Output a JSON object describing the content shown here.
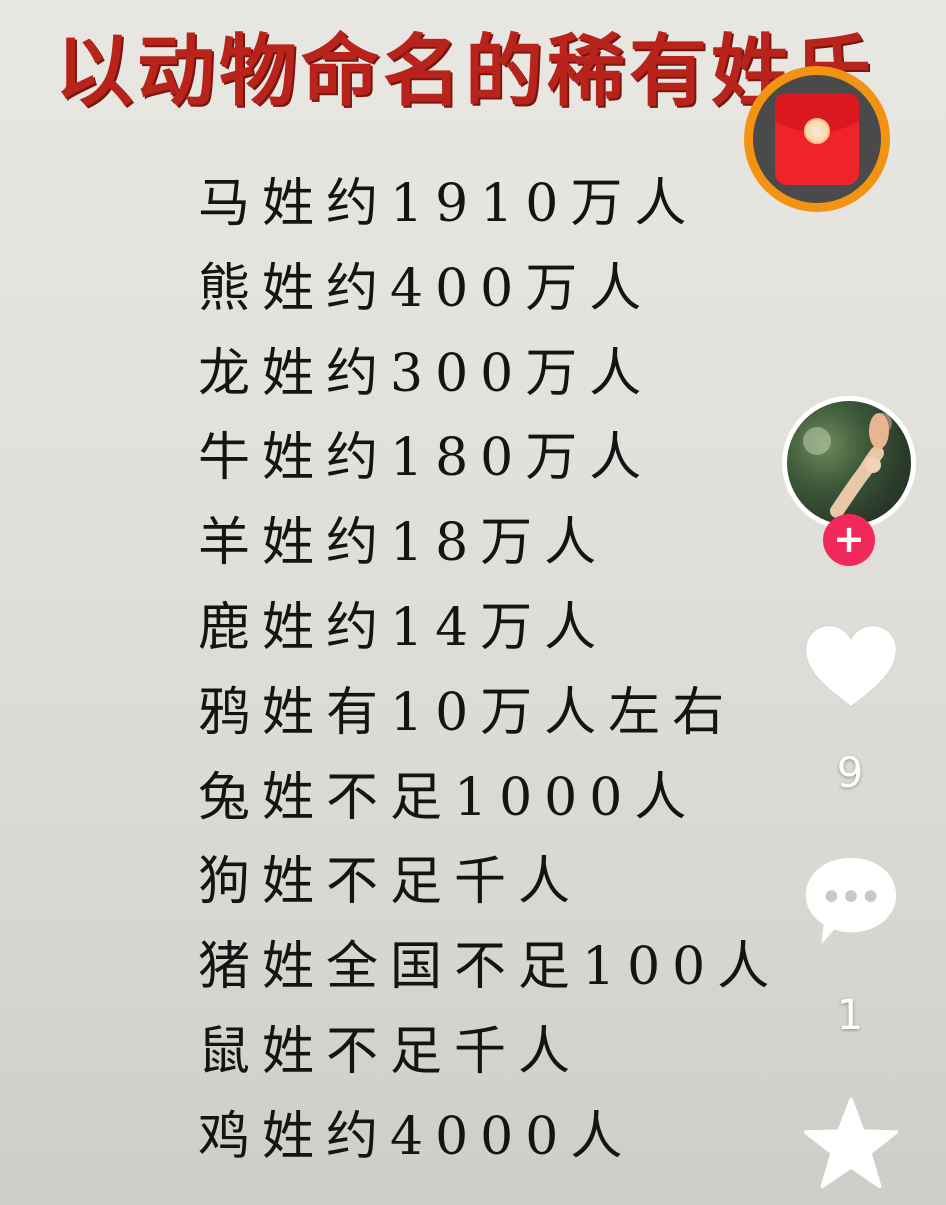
{
  "title": "以动物命名的稀有姓氏",
  "surnames": [
    "马姓约1910万人",
    "熊姓约400万人",
    "龙姓约300万人",
    "牛姓约180万人",
    "羊姓约18万人",
    "鹿姓约14万人",
    "鸦姓有10万人左右",
    "兔姓不足1000人",
    "狗姓不足千人",
    "猪姓全国不足100人",
    "鼠姓不足千人",
    "鸡姓约4000人"
  ],
  "sidebar": {
    "follow_symbol": "+",
    "like_count": "9",
    "comment_count": "1"
  },
  "icons": {
    "red_packet": "red-packet-icon",
    "like": "heart-icon",
    "comment": "comment-icon",
    "favorite": "star-icon"
  },
  "colors": {
    "title": "#b8241c",
    "accent_ring": "#f29314",
    "follow_badge": "#f1295b"
  }
}
